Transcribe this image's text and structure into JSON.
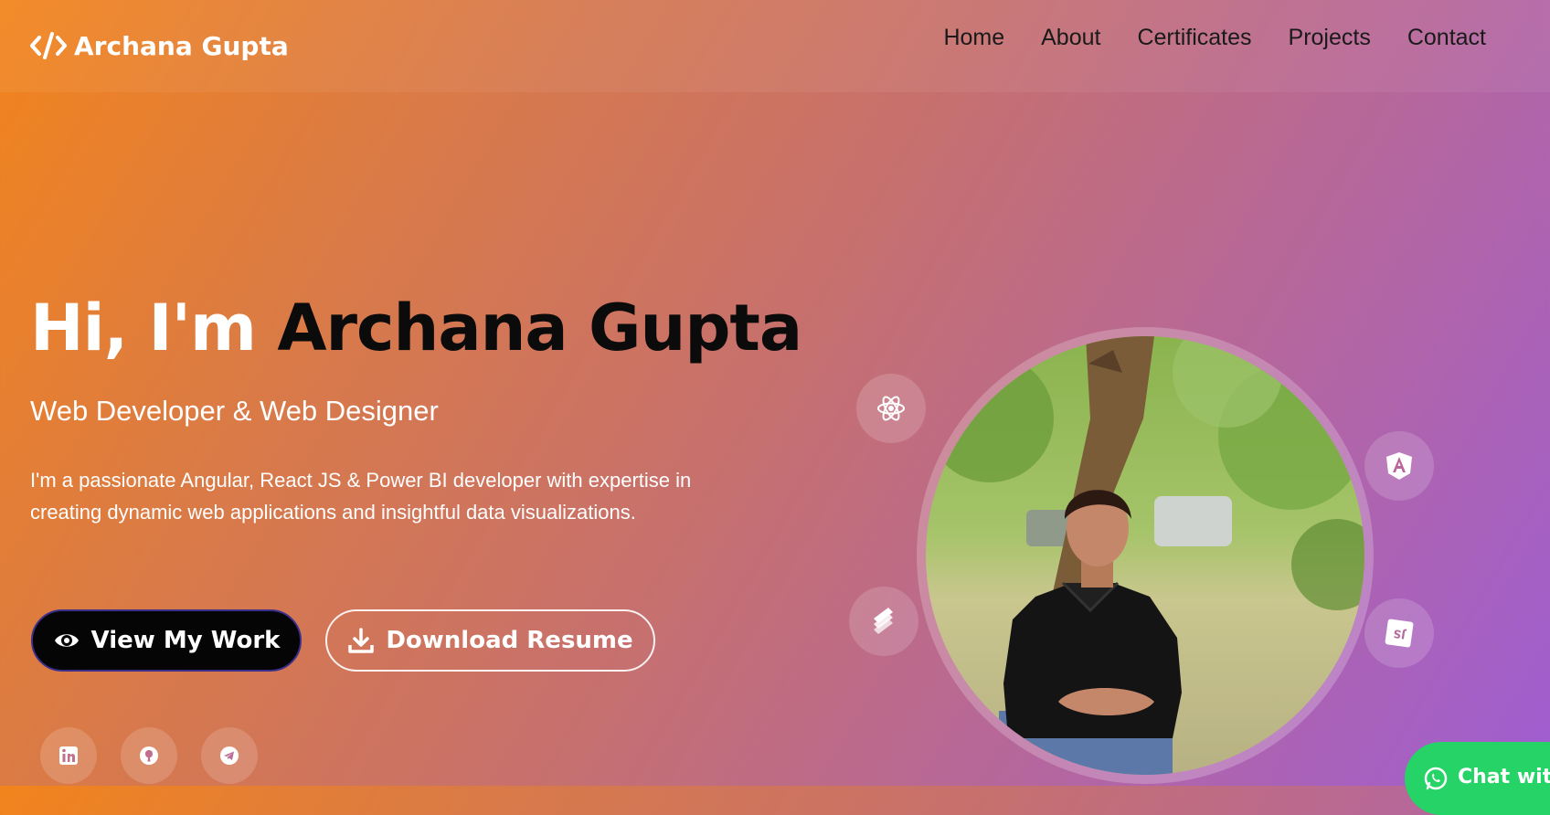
{
  "brand": {
    "name": "Archana Gupta",
    "icon": "code-icon"
  },
  "nav": {
    "items": [
      {
        "label": "Home"
      },
      {
        "label": "About"
      },
      {
        "label": "Certificates"
      },
      {
        "label": "Projects"
      },
      {
        "label": "Contact"
      }
    ]
  },
  "hero": {
    "greeting": "Hi, I'm ",
    "name": "Archana Gupta",
    "subtitle": "Web Developer & Web Designer",
    "description": "I'm a passionate Angular, React JS & Power BI developer with expertise in creating dynamic web applications and insightful data visualizations.",
    "primary_button": {
      "label": "View My Work",
      "icon": "eye-icon"
    },
    "secondary_button": {
      "label": "Download Resume",
      "icon": "download-icon"
    }
  },
  "social_links": [
    {
      "icon": "linkedin-icon"
    },
    {
      "icon": "github-icon"
    },
    {
      "icon": "telegram-icon"
    }
  ],
  "tech_badges": [
    {
      "icon": "react-icon"
    },
    {
      "icon": "angular-icon"
    },
    {
      "icon": "power-bi-icon"
    },
    {
      "icon": "javascript-icon"
    }
  ],
  "chat": {
    "label": "Chat with",
    "icon": "whatsapp-icon"
  },
  "colors": {
    "gradient_start": "#f2841c",
    "gradient_end": "#9f5ed2",
    "primary_button": "#050505",
    "whatsapp": "#25d366"
  }
}
